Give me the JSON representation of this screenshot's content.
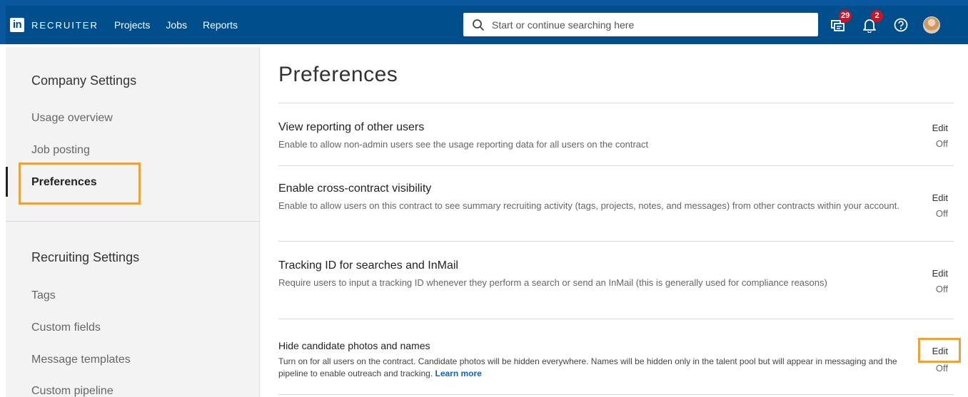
{
  "header": {
    "logo": "in",
    "brand": "RECRUITER",
    "nav": [
      "Projects",
      "Jobs",
      "Reports"
    ],
    "search_placeholder": "Start or continue searching here",
    "messages_count": "29",
    "notifications_count": "2"
  },
  "sidebar": {
    "company_heading": "Company Settings",
    "company_items": [
      "Usage overview",
      "Job posting",
      "Preferences"
    ],
    "recruiting_heading": "Recruiting Settings",
    "recruiting_items": [
      "Tags",
      "Custom fields",
      "Message templates",
      "Custom pipeline"
    ]
  },
  "main": {
    "title": "Preferences",
    "preferences": [
      {
        "title": "View reporting of other users",
        "description": "Enable to allow non-admin users see the usage reporting data for all users on the contract",
        "edit": "Edit",
        "state": "Off"
      },
      {
        "title": "Enable cross-contract visibility",
        "description": "Enable to allow users on this contract to see summary recruiting activity (tags, projects, notes, and messages) from other contracts within your account.",
        "edit": "Edit",
        "state": "Off"
      },
      {
        "title": "Tracking ID for searches and InMail",
        "description": "Require users to input a tracking ID whenever they perform a search or send an InMail (this is generally used for compliance reasons)",
        "edit": "Edit",
        "state": "Off"
      },
      {
        "title": "Hide candidate photos and names",
        "description": "Turn on for all users on the contract. Candidate photos will be hidden everywhere. Names will be hidden only in the talent pool but will appear in messaging and the pipeline to enable outreach and tracking.",
        "link": "Learn more",
        "edit": "Edit",
        "state": "Off"
      }
    ]
  },
  "colors": {
    "header_bg": "#004e8c",
    "highlight": "#e8a33d",
    "badge": "#d11124",
    "link": "#0a66c2"
  },
  "icons": [
    "search-icon",
    "messages-icon",
    "notifications-icon",
    "help-icon",
    "avatar"
  ]
}
